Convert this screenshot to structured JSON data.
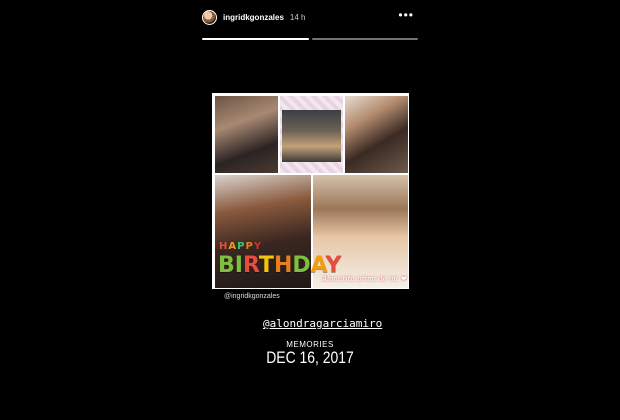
{
  "story": {
    "username": "ingridkgonzales",
    "time": "14 h",
    "more_icon": "more-dots-icon",
    "progress": [
      1.0,
      0.0
    ]
  },
  "collage": {
    "happy": [
      "H",
      "A",
      "P",
      "P",
      "Y"
    ],
    "happy_colors": [
      "#e74c3c",
      "#f39c12",
      "#2ecc71",
      "#e67e22",
      "#c0392b"
    ],
    "birthday": [
      "B",
      "I",
      "R",
      "T",
      "H",
      "D",
      "A",
      "Y"
    ],
    "birthday_colors": [
      "#7fbf3f",
      "#7fbf3f",
      "#e74c3c",
      "#f1c40f",
      "#e67e22",
      "#7fbf3f",
      "#f39c12",
      "#e74c3c"
    ],
    "caption": "Alonarita primi de mi ❤",
    "credit": "@ingridkgonzales"
  },
  "mention": "@alondragarciamiro",
  "memories": {
    "label": "MEMORIES",
    "date": "DEC 16, 2017"
  }
}
